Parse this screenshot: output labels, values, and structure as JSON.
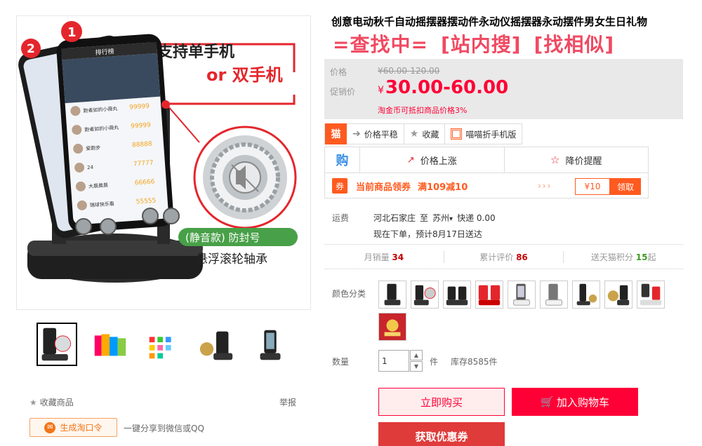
{
  "product": {
    "title": "创意电动秋千自动摇摆器摆动件永动仪摇摆器永动摆件男女生日礼物",
    "search_links": [
      "=查找中=",
      "[站内搜]",
      "[找相似]"
    ]
  },
  "main_image": {
    "badge_1": "1",
    "badge_2": "2",
    "headline_line1": "支持单手机",
    "headline_line2": "or 双手机",
    "pill": "(静音款) 防封号",
    "caption": "悬浮滚轮轴承",
    "phone_app_title": "排行榜",
    "phone_rows": [
      {
        "name": "跑者如的小薇丸",
        "score": "99999"
      },
      {
        "name": "跑者如的小薇丸",
        "score": "99999"
      },
      {
        "name": "爱跑步",
        "score": "88888"
      },
      {
        "name": "24",
        "score": "77777"
      },
      {
        "name": "大晨晨晨",
        "score": "66666"
      },
      {
        "name": "瑞球快乐看",
        "score": "55555"
      }
    ]
  },
  "left_footer": {
    "favorite_label": "收藏商品",
    "report_label": "举报",
    "taokouling_label": "生成淘口令",
    "share_label": "一键分享到微信或QQ"
  },
  "price": {
    "original_label": "价格",
    "original_value": "¥60.00-120.00",
    "promo_label": "促销价",
    "promo_currency": "¥",
    "promo_value": "30.00-60.00",
    "taojinbi_note": "淘金币可抵扣商品价格3%"
  },
  "toolbar": {
    "price_stable": "价格平稳",
    "collect": "收藏",
    "mobile": "喵喵折手机版"
  },
  "trend": {
    "gou_icon_text": "购",
    "price_up": "价格上涨",
    "price_drop_alert": "降价提醒",
    "coupon_badge": "券",
    "coupon_text": "当前商品领券",
    "coupon_rule": "满109减10",
    "arrows": "›››",
    "coupon_amount": "¥10",
    "coupon_button": "领取"
  },
  "shipping": {
    "label": "运费",
    "from": "河北石家庄",
    "to_word": "至",
    "to": "苏州",
    "method": "快递 0.00",
    "eta": "现在下单，预计8月17日送达"
  },
  "stats": {
    "monthly_sales_label": "月销量",
    "monthly_sales_value": "34",
    "reviews_label": "累计评价",
    "reviews_value": "86",
    "points_label": "送天猫积分",
    "points_value": "15",
    "points_suffix": "起"
  },
  "sku": {
    "color_label": "颜色分类",
    "swatch_count": 10
  },
  "quantity": {
    "label": "数量",
    "value": "1",
    "unit": "件",
    "stock": "库存8585件"
  },
  "actions": {
    "buy_now": "立即购买",
    "add_to_cart": "加入购物车",
    "get_coupon": "获取优惠券"
  },
  "colors": {
    "price_red": "#ff0036",
    "coupon_orange": "#ff5a1f",
    "cart_red": "#ff0036",
    "search_pink": "#f04a62"
  }
}
